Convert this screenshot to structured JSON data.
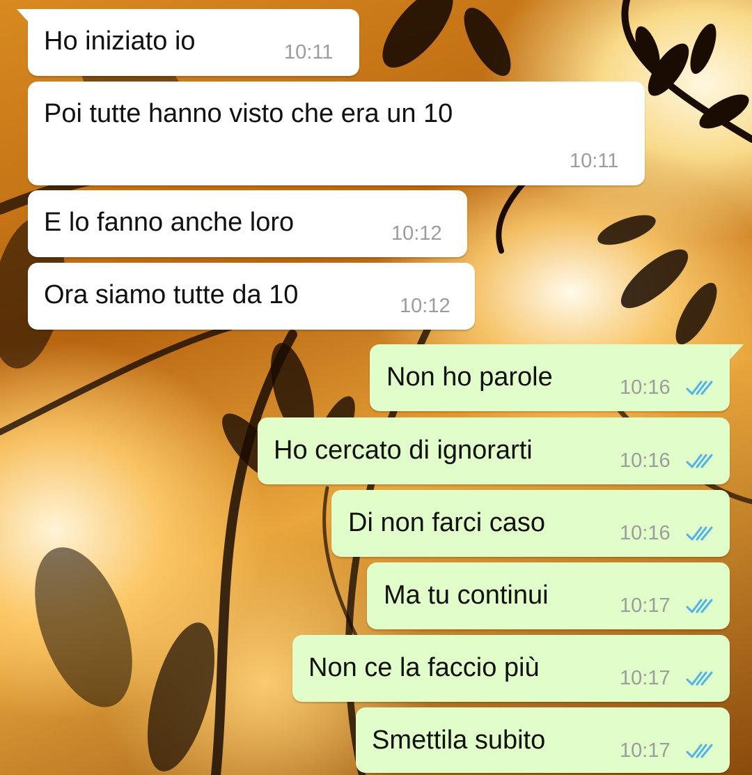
{
  "conversation": {
    "incoming": [
      {
        "text": "Ho iniziato io",
        "time": "10:11"
      },
      {
        "text": "Poi tutte hanno visto che era un 10",
        "time": "10:11"
      },
      {
        "text": "E lo fanno anche loro",
        "time": "10:12"
      },
      {
        "text": "Ora siamo tutte da 10",
        "time": "10:12"
      }
    ],
    "outgoing": [
      {
        "text": "Non ho parole",
        "time": "10:16",
        "status": "read"
      },
      {
        "text": "Ho cercato di ignorarti",
        "time": "10:16",
        "status": "read"
      },
      {
        "text": "Di non farci caso",
        "time": "10:16",
        "status": "read"
      },
      {
        "text": "Ma tu continui",
        "time": "10:17",
        "status": "read"
      },
      {
        "text": "Non ce la faccio più",
        "time": "10:17",
        "status": "read"
      },
      {
        "text": "Smettila subito",
        "time": "10:17",
        "status": "read"
      }
    ]
  },
  "colors": {
    "incoming_bubble": "#ffffff",
    "outgoing_bubble": "#e1fdc9",
    "read_ticks": "#4fb3e8",
    "timestamp": "#9c9c9c"
  },
  "icons": {
    "read_receipt": "double-check-icon",
    "wallpaper": "wheat-silhouette-sunset"
  }
}
